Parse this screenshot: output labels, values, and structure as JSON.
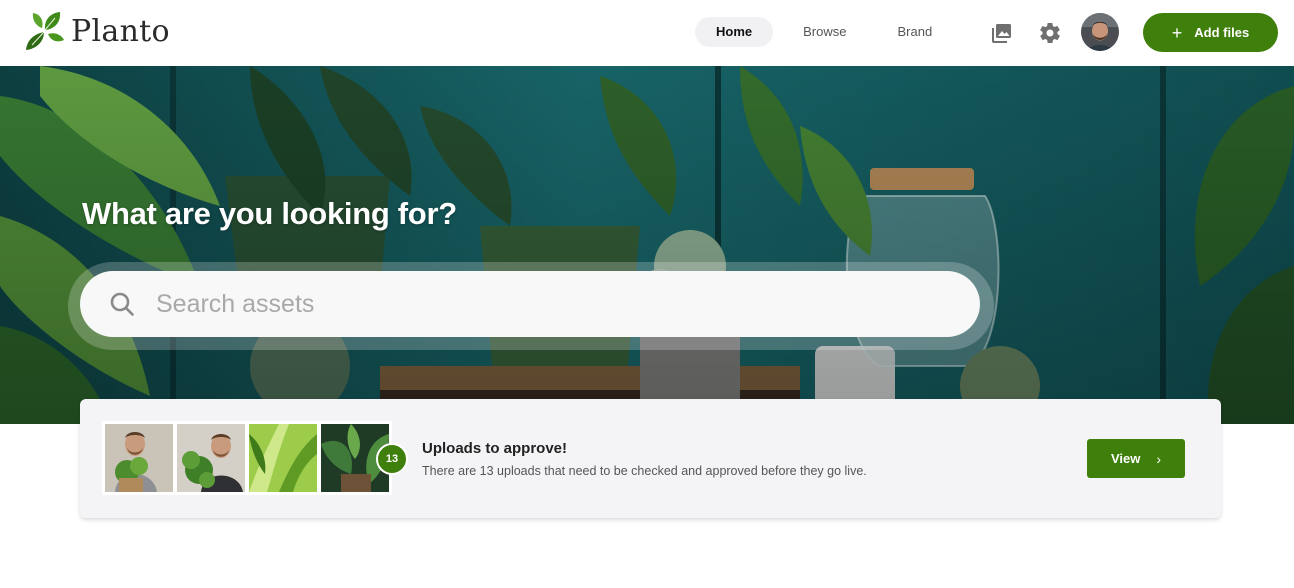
{
  "brand": {
    "name": "Planto",
    "logo_icon": "leaf-logo-icon",
    "accent": "#3f7f0c"
  },
  "nav": {
    "tabs": [
      {
        "label": "Home",
        "active": true
      },
      {
        "label": "Browse",
        "active": false
      },
      {
        "label": "Brand",
        "active": false
      }
    ]
  },
  "header_actions": {
    "gallery_icon": "image-gallery-icon",
    "settings_icon": "gear-icon",
    "avatar_icon": "user-avatar",
    "add_files_label": "Add files"
  },
  "hero": {
    "title": "What are you looking for?",
    "search_placeholder": "Search assets",
    "search_value": ""
  },
  "uploads": {
    "count": "13",
    "title": "Uploads to approve!",
    "description": "There are 13 uploads that need to be checked and approved before they go live.",
    "view_label": "View",
    "thumbnails": [
      "man-with-plant-photo",
      "man-holding-plant-photo",
      "green-leaves-photo",
      "houseplants-photo"
    ]
  }
}
